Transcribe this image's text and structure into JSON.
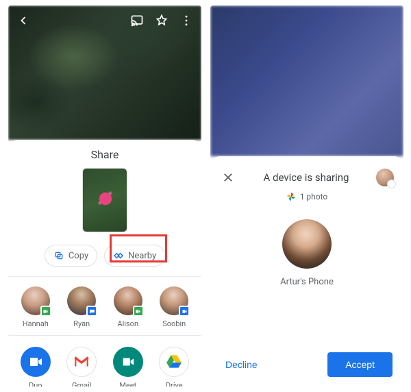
{
  "left": {
    "share_title": "Share",
    "chips": {
      "copy": "Copy",
      "nearby": "Nearby"
    },
    "contacts": [
      {
        "name": "Hannah",
        "badge": "green"
      },
      {
        "name": "Ryan",
        "badge": "blue"
      },
      {
        "name": "Alison",
        "badge": "green"
      },
      {
        "name": "Soobin",
        "badge": "blue"
      }
    ],
    "apps": [
      {
        "name": "Duo"
      },
      {
        "name": "Gmail"
      },
      {
        "name": "Meet"
      },
      {
        "name": "Drive"
      }
    ]
  },
  "right": {
    "title": "A device is sharing",
    "photo_count": "1 photo",
    "device_name": "Artur's Phone",
    "decline": "Decline",
    "accept": "Accept"
  }
}
